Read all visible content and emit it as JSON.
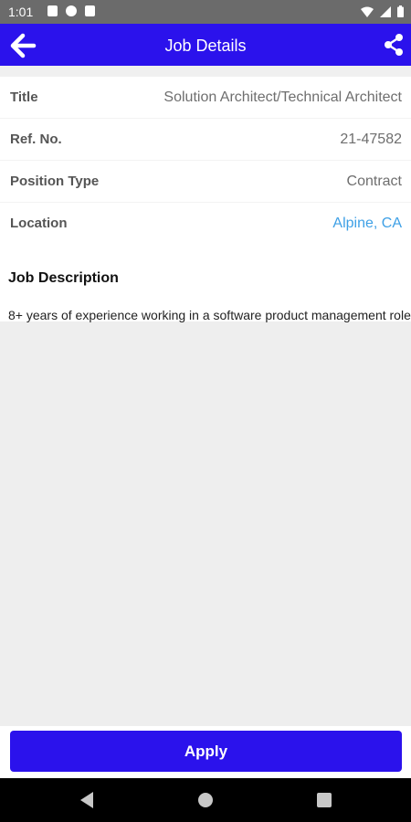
{
  "status_bar": {
    "time": "1:01"
  },
  "app_bar": {
    "title": "Job Details"
  },
  "details": [
    {
      "label": "Title",
      "value": "Solution Architect/Technical Architect"
    },
    {
      "label": "Ref. No.",
      "value": "21-47582"
    },
    {
      "label": "Position Type",
      "value": "Contract"
    },
    {
      "label": "Location",
      "value": "Alpine, CA"
    }
  ],
  "description": {
    "heading": "Job Description",
    "text": "8+ years of experience working in a software product management role"
  },
  "apply": {
    "label": "Apply"
  },
  "colors": {
    "primary": "#2b12ec",
    "link": "#3ea0e6",
    "background": "#eeeeee"
  }
}
